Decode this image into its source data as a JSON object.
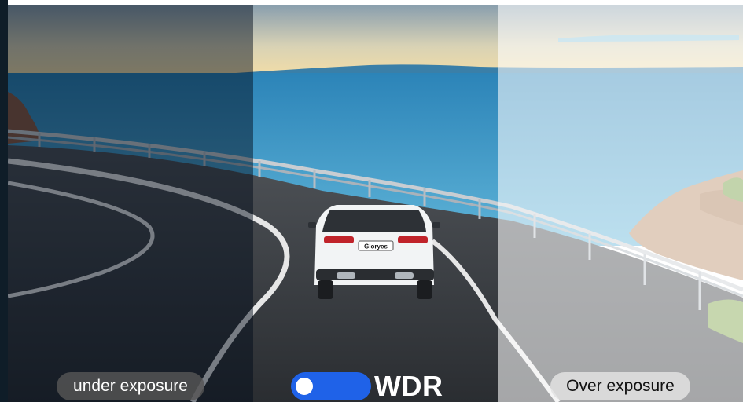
{
  "labels": {
    "under_exposure": "under exposure",
    "wdr": "WDR",
    "over_exposure": "Over exposure",
    "plate": "Gloryes"
  },
  "toggle": {
    "state": "on",
    "color": "#1f62e8"
  },
  "icons": [
    "toggle-switch-icon"
  ]
}
